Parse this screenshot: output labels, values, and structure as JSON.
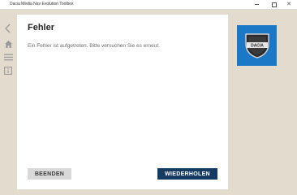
{
  "window": {
    "title": "Dacia Media Nav Evolution Toolbox",
    "minimize_icon": "minimize-icon",
    "maximize_icon": "maximize-icon",
    "close_glyph": "✕"
  },
  "sidebar": {
    "icons": [
      "back-icon",
      "home-icon",
      "menu-icon",
      "info-icon"
    ]
  },
  "error_card": {
    "title": "Fehler",
    "message": "Ein Fehler ist aufgetreten. Bitte versuchen Sie es erneut.",
    "left_button_label": "BEENDEN",
    "right_button_label": "WIEDERHOLEN"
  },
  "brand": {
    "logo_text": "DACIA",
    "logo_icon": "dacia-logo",
    "tile_color": "#1a78c7",
    "primary_button_color": "#163b63"
  }
}
